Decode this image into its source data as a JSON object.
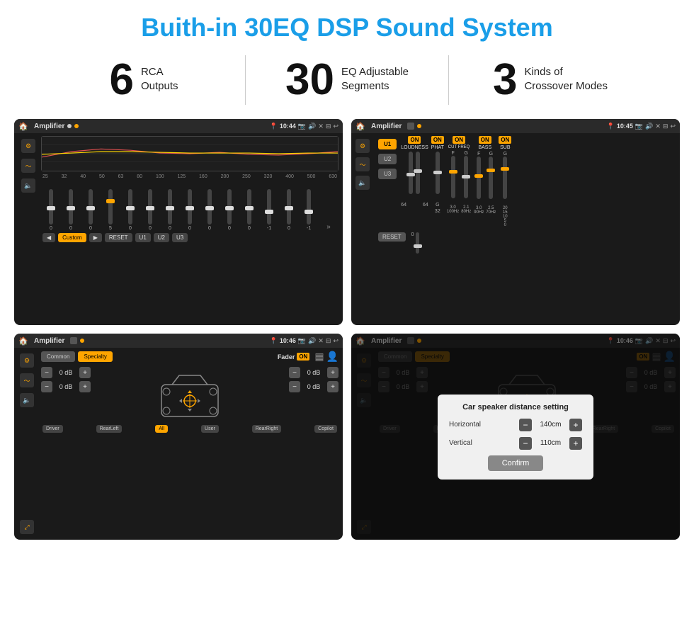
{
  "header": {
    "title": "Buith-in 30EQ DSP Sound System"
  },
  "stats": [
    {
      "number": "6",
      "label": "RCA\nOutputs"
    },
    {
      "number": "30",
      "label": "EQ Adjustable\nSegments"
    },
    {
      "number": "3",
      "label": "Kinds of\nCrossover Modes"
    }
  ],
  "screens": [
    {
      "id": "eq-screen",
      "statusBar": {
        "title": "Amplifier",
        "time": "10:44"
      },
      "freqLabels": [
        "25",
        "32",
        "40",
        "50",
        "63",
        "80",
        "100",
        "125",
        "160",
        "200",
        "250",
        "320",
        "400",
        "500",
        "630"
      ],
      "sliderValues": [
        "0",
        "0",
        "0",
        "5",
        "0",
        "0",
        "0",
        "0",
        "0",
        "0",
        "0",
        "-1",
        "0",
        "-1"
      ],
      "bottomButtons": [
        "◀",
        "Custom",
        "▶",
        "RESET",
        "U1",
        "U2",
        "U3"
      ]
    },
    {
      "id": "crossover-screen",
      "statusBar": {
        "title": "Amplifier",
        "time": "10:45"
      },
      "presets": [
        "U1",
        "U2",
        "U3"
      ],
      "channels": [
        "LOUDNESS",
        "PHAT",
        "CUT FREQ",
        "BASS",
        "SUB"
      ],
      "resetLabel": "RESET"
    },
    {
      "id": "fader-screen",
      "statusBar": {
        "title": "Amplifier",
        "time": "10:46"
      },
      "tabs": [
        "Common",
        "Specialty"
      ],
      "faderLabel": "Fader",
      "faderOnLabel": "ON",
      "volumes": [
        "0 dB",
        "0 dB",
        "0 dB",
        "0 dB"
      ],
      "bottomButtons": [
        "Driver",
        "RearLeft",
        "All",
        "User",
        "RearRight",
        "Copilot"
      ]
    },
    {
      "id": "dialog-screen",
      "statusBar": {
        "title": "Amplifier",
        "time": "10:46"
      },
      "tabs": [
        "Common",
        "Specialty"
      ],
      "dialog": {
        "title": "Car speaker distance setting",
        "horizontal": {
          "label": "Horizontal",
          "value": "140cm"
        },
        "vertical": {
          "label": "Vertical",
          "value": "110cm"
        },
        "confirmLabel": "Confirm"
      }
    }
  ]
}
